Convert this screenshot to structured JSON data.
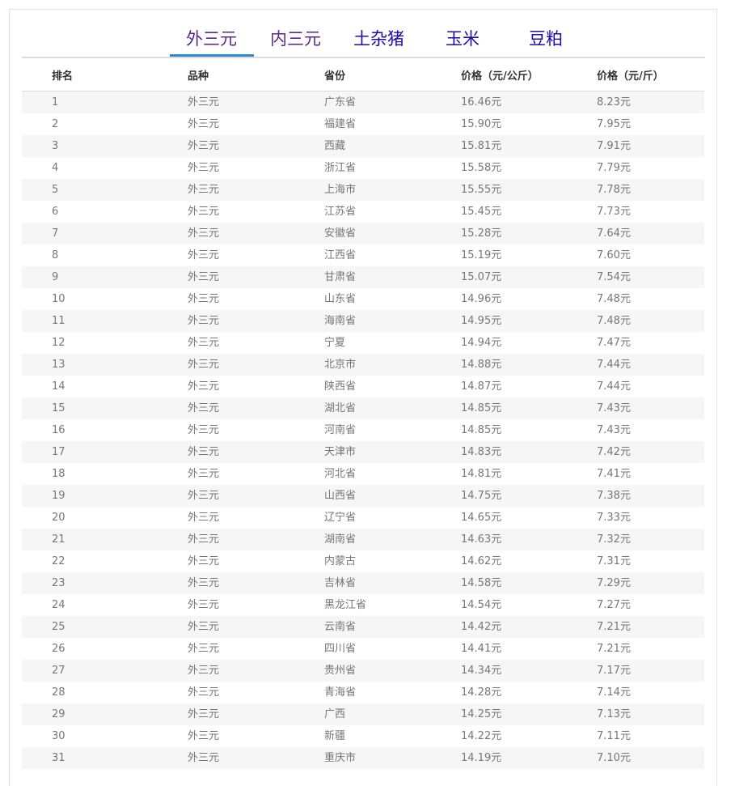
{
  "tabs": [
    {
      "label": "外三元",
      "state": "active"
    },
    {
      "label": "内三元",
      "state": "visited"
    },
    {
      "label": "土杂猪",
      "state": "link"
    },
    {
      "label": "玉米",
      "state": "link"
    },
    {
      "label": "豆粕",
      "state": "link"
    }
  ],
  "colors": {
    "active_tab_underline": "#2b8bd9",
    "visited_link": "#5b2a86",
    "link": "#1a0dab",
    "stripe": "#f6f6f6"
  },
  "table": {
    "headers": [
      "排名",
      "品种",
      "省份",
      "价格（元/公斤）",
      "价格（元/斤）"
    ],
    "rows": [
      [
        "1",
        "外三元",
        "广东省",
        "16.46元",
        "8.23元"
      ],
      [
        "2",
        "外三元",
        "福建省",
        "15.90元",
        "7.95元"
      ],
      [
        "3",
        "外三元",
        "西藏",
        "15.81元",
        "7.91元"
      ],
      [
        "4",
        "外三元",
        "浙江省",
        "15.58元",
        "7.79元"
      ],
      [
        "5",
        "外三元",
        "上海市",
        "15.55元",
        "7.78元"
      ],
      [
        "6",
        "外三元",
        "江苏省",
        "15.45元",
        "7.73元"
      ],
      [
        "7",
        "外三元",
        "安徽省",
        "15.28元",
        "7.64元"
      ],
      [
        "8",
        "外三元",
        "江西省",
        "15.19元",
        "7.60元"
      ],
      [
        "9",
        "外三元",
        "甘肃省",
        "15.07元",
        "7.54元"
      ],
      [
        "10",
        "外三元",
        "山东省",
        "14.96元",
        "7.48元"
      ],
      [
        "11",
        "外三元",
        "海南省",
        "14.95元",
        "7.48元"
      ],
      [
        "12",
        "外三元",
        "宁夏",
        "14.94元",
        "7.47元"
      ],
      [
        "13",
        "外三元",
        "北京市",
        "14.88元",
        "7.44元"
      ],
      [
        "14",
        "外三元",
        "陕西省",
        "14.87元",
        "7.44元"
      ],
      [
        "15",
        "外三元",
        "湖北省",
        "14.85元",
        "7.43元"
      ],
      [
        "16",
        "外三元",
        "河南省",
        "14.85元",
        "7.43元"
      ],
      [
        "17",
        "外三元",
        "天津市",
        "14.83元",
        "7.42元"
      ],
      [
        "18",
        "外三元",
        "河北省",
        "14.81元",
        "7.41元"
      ],
      [
        "19",
        "外三元",
        "山西省",
        "14.75元",
        "7.38元"
      ],
      [
        "20",
        "外三元",
        "辽宁省",
        "14.65元",
        "7.33元"
      ],
      [
        "21",
        "外三元",
        "湖南省",
        "14.63元",
        "7.32元"
      ],
      [
        "22",
        "外三元",
        "内蒙古",
        "14.62元",
        "7.31元"
      ],
      [
        "23",
        "外三元",
        "吉林省",
        "14.58元",
        "7.29元"
      ],
      [
        "24",
        "外三元",
        "黑龙江省",
        "14.54元",
        "7.27元"
      ],
      [
        "25",
        "外三元",
        "云南省",
        "14.42元",
        "7.21元"
      ],
      [
        "26",
        "外三元",
        "四川省",
        "14.41元",
        "7.21元"
      ],
      [
        "27",
        "外三元",
        "贵州省",
        "14.34元",
        "7.17元"
      ],
      [
        "28",
        "外三元",
        "青海省",
        "14.28元",
        "7.14元"
      ],
      [
        "29",
        "外三元",
        "广西",
        "14.25元",
        "7.13元"
      ],
      [
        "30",
        "外三元",
        "新疆",
        "14.22元",
        "7.11元"
      ],
      [
        "31",
        "外三元",
        "重庆市",
        "14.19元",
        "7.10元"
      ]
    ]
  }
}
